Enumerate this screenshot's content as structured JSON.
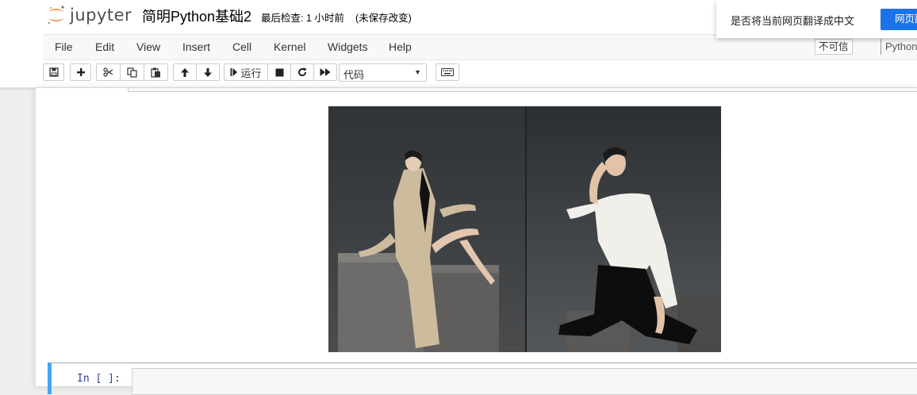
{
  "header": {
    "logo_text": "jupyter",
    "notebook_name": "简明Python基础2",
    "checkpoint": "最后检查: 1 小时前",
    "autosave_status": "(未保存改变)"
  },
  "translate_popup": {
    "message": "是否将当前网页翻译成中文",
    "button_label": "网页翻"
  },
  "menubar": {
    "items": [
      "File",
      "Edit",
      "View",
      "Insert",
      "Cell",
      "Kernel",
      "Widgets",
      "Help"
    ],
    "trusted_label": "不可信",
    "kernel_name": "Python"
  },
  "toolbar": {
    "run_label": "运行",
    "cell_type": "代码",
    "icons": [
      "save-icon",
      "plus-icon",
      "scissors-icon",
      "copy-icon",
      "paste-icon",
      "arrow-up-icon",
      "arrow-down-icon",
      "run-icon",
      "stop-icon",
      "restart-icon",
      "fast-forward-icon",
      "keyboard-icon"
    ]
  },
  "cell": {
    "prompt": "In  [ ]:"
  },
  "colors": {
    "accent": "#42a5f5",
    "translate_button": "#1a73e8",
    "jupyter_orange": "#f37726"
  }
}
